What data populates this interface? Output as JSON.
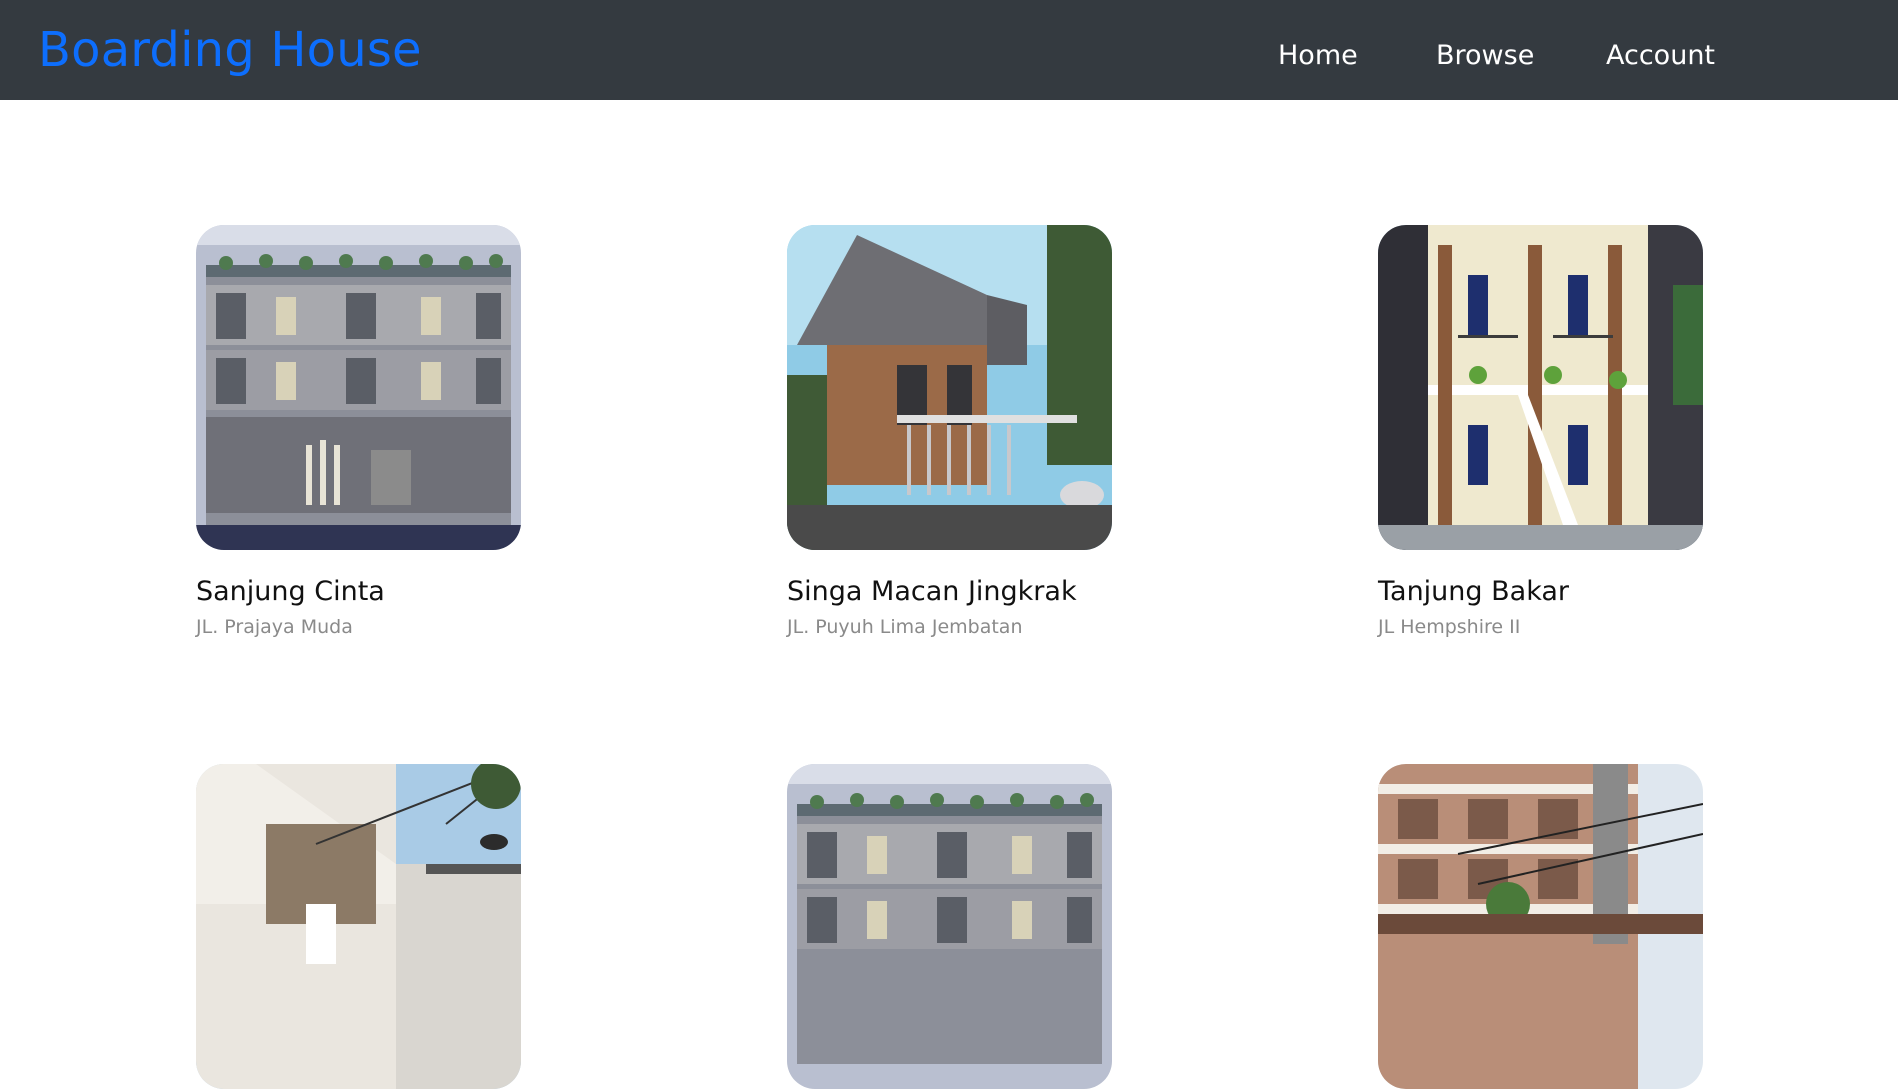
{
  "navbar": {
    "brand": "Boarding House",
    "links": [
      {
        "label": "Home"
      },
      {
        "label": "Browse"
      },
      {
        "label": "Account"
      }
    ]
  },
  "colors": {
    "navbar_bg": "#343a40",
    "brand": "#0d6efd",
    "link": "#ffffff",
    "title": "#111111",
    "address": "#8a8a8a"
  },
  "listings": [
    {
      "name": "Sanjung Cinta",
      "address": "JL. Prajaya Muda",
      "image": "modern-grey-building-photo"
    },
    {
      "name": "Singa Macan Jingkrak",
      "address": "JL. Puyuh Lima Jembatan",
      "image": "brick-modern-house-photo"
    },
    {
      "name": "Tanjung Bakar",
      "address": "JL Hempshire II",
      "image": "two-storey-kost-photo"
    },
    {
      "name": "",
      "address": "",
      "image": "white-minimal-building-photo"
    },
    {
      "name": "",
      "address": "",
      "image": "modern-grey-building-photo"
    },
    {
      "name": "",
      "address": "",
      "image": "brick-apartment-photo"
    }
  ]
}
